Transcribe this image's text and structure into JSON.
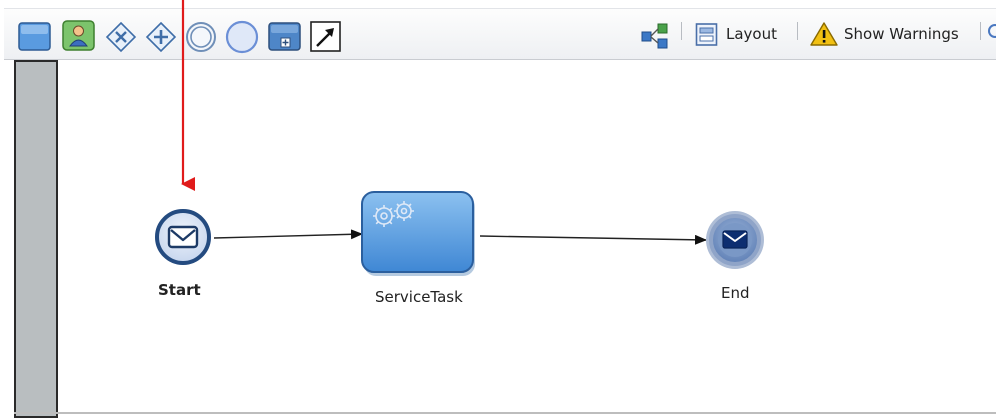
{
  "toolbar": {
    "tools": [
      {
        "icon": "swimlane-icon"
      },
      {
        "icon": "user-task-icon"
      },
      {
        "icon": "exclusive-gateway-icon"
      },
      {
        "icon": "parallel-gateway-icon"
      },
      {
        "icon": "intermediate-event-icon"
      },
      {
        "icon": "start-event-icon"
      },
      {
        "icon": "subprocess-icon"
      },
      {
        "icon": "connector-arrow-icon"
      }
    ],
    "layout_label": "Layout",
    "warnings_label": "Show Warnings"
  },
  "diagram": {
    "start": {
      "label": "Start",
      "icon": "envelope-icon"
    },
    "task": {
      "label": "ServiceTask",
      "icon": "gears-icon"
    },
    "end": {
      "label": "End",
      "icon": "envelope-icon"
    }
  },
  "colors": {
    "annotation_arrow": "#e01b1b",
    "task_fill": "#5d9fde",
    "event_ring": "#2f5f95",
    "lane_fill": "#b9bec0"
  }
}
